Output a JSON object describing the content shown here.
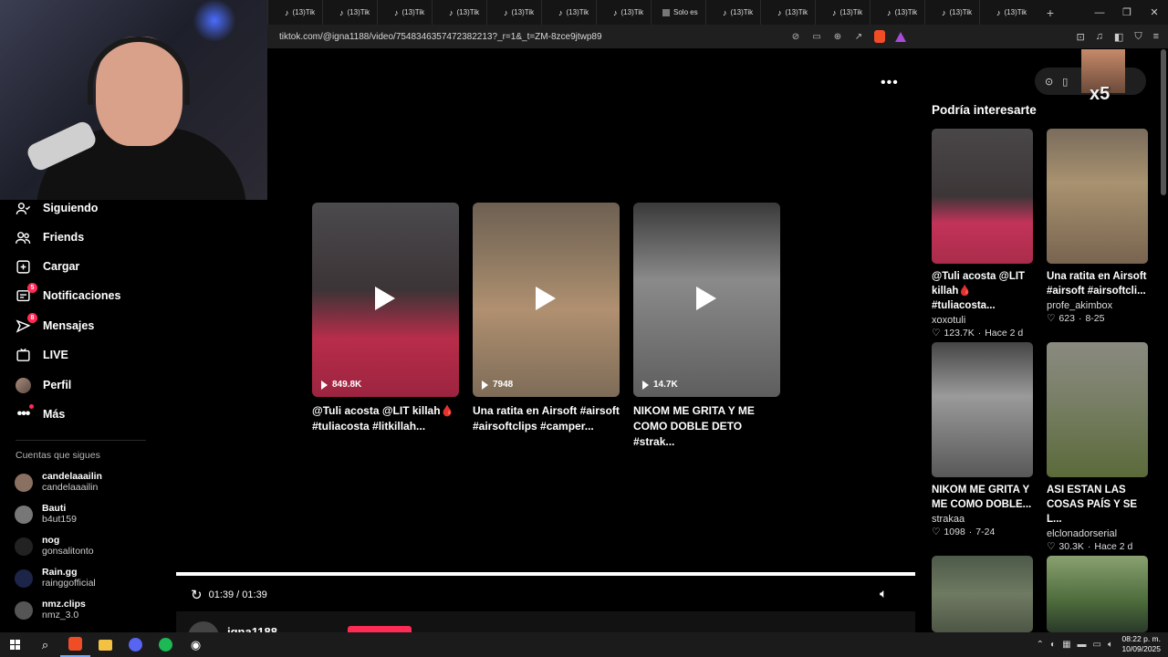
{
  "browser": {
    "tabs": [
      {
        "label": "(13)Tik",
        "icon": "tiktok-icon"
      },
      {
        "label": "(13)Tik",
        "icon": "tiktok-icon"
      },
      {
        "label": "(13)Tik",
        "icon": "tiktok-icon"
      },
      {
        "label": "(13)Tik",
        "icon": "tiktok-icon"
      },
      {
        "label": "(13)Tik",
        "icon": "tiktok-icon"
      },
      {
        "label": "(13)Tik",
        "icon": "tiktok-icon"
      },
      {
        "label": "(13)Tik",
        "icon": "tiktok-icon"
      },
      {
        "label": "Solo es",
        "icon": ""
      },
      {
        "label": "(13)Tik",
        "icon": "tiktok-icon"
      },
      {
        "label": "(13)Tik",
        "icon": "tiktok-icon"
      },
      {
        "label": "(13)Tik",
        "icon": "tiktok-icon"
      },
      {
        "label": "(13)Tik",
        "icon": "tiktok-icon"
      },
      {
        "label": "(13)Tik",
        "icon": "tiktok-icon"
      },
      {
        "label": "(13)Tik",
        "icon": "tiktok-icon"
      }
    ],
    "new_tab": "+",
    "url": "tiktok.com/@igna1188/video/7548346357472382213?_r=1&_t=ZM-8zce9jtwp89"
  },
  "sidebar": {
    "items": [
      {
        "label": "Siguiendo",
        "icon": "following-icon"
      },
      {
        "label": "Friends",
        "icon": "friends-icon"
      },
      {
        "label": "Cargar",
        "icon": "upload-icon"
      },
      {
        "label": "Notificaciones",
        "icon": "inbox-icon",
        "badge": "5"
      },
      {
        "label": "Mensajes",
        "icon": "messages-icon",
        "badge": "8"
      },
      {
        "label": "LIVE",
        "icon": "live-icon"
      },
      {
        "label": "Perfil",
        "icon": "profile-avatar"
      },
      {
        "label": "Más",
        "icon": "more-icon"
      }
    ],
    "following_title": "Cuentas que sigues",
    "following": [
      {
        "name": "candelaaailin",
        "handle": "candelaaailin"
      },
      {
        "name": "Bauti",
        "handle": "b4ut159"
      },
      {
        "name": "nog",
        "handle": "gonsalitonto"
      },
      {
        "name": "Rain.gg",
        "handle": "rainggofficial"
      },
      {
        "name": "nmz.clips",
        "handle": "nmz_3.0"
      }
    ]
  },
  "main": {
    "recommended": [
      {
        "views": "849.8K",
        "caption": "@Tuli acosta @LIT killah🩸 #tuliacosta #litkillah..."
      },
      {
        "views": "7948",
        "caption": "Una ratita en Airsoft #airsoft #airsoftclips #camper..."
      },
      {
        "views": "14.7K",
        "caption": "NIKOM ME GRITA Y ME COMO DOBLE DETO #strak..."
      }
    ],
    "time": "01:39 / 01:39",
    "progress": 1.0,
    "author": "igna1188"
  },
  "right_panel": {
    "overlay_text": "x5",
    "title": "Podría interesarte",
    "cards": [
      {
        "caption": "@Tuli acosta @LIT killah🩸 #tuliacosta...",
        "author": "xoxotuli",
        "likes": "123.7K",
        "date": "Hace 2 d"
      },
      {
        "caption": "Una ratita en Airsoft #airsoft #airsoftcli...",
        "author": "profe_akimbox",
        "likes": "623",
        "date": "8-25"
      },
      {
        "caption": "NIKOM ME GRITA Y ME COMO DOBLE...",
        "author": "strakaa",
        "likes": "1098",
        "date": "7-24"
      },
      {
        "caption": "ASI ESTAN LAS COSAS PAÍS Y SE L...",
        "author": "elclonadorserial",
        "likes": "30.3K",
        "date": "Hace 2 d"
      }
    ]
  },
  "taskbar": {
    "time": "08:22 p. m.",
    "date": "10/09/2025"
  }
}
